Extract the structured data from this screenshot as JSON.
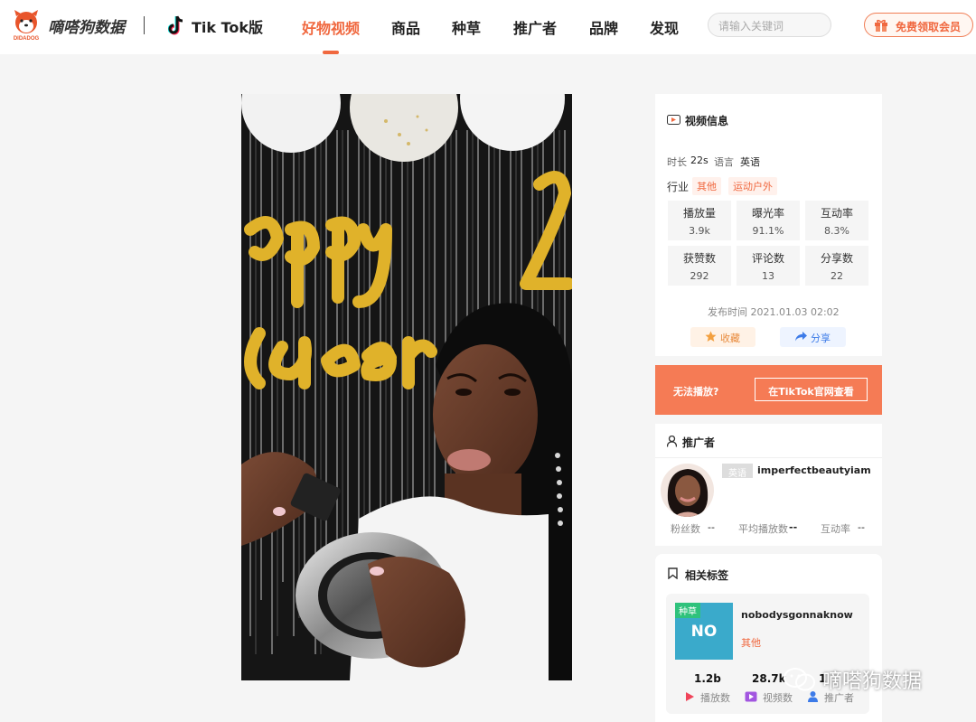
{
  "header": {
    "brand": "嘀嗒狗数据",
    "logo_caption": "DIDADOG",
    "platform": "Tik Tok版",
    "nav": [
      "好物视频",
      "商品",
      "种草",
      "推广者",
      "品牌",
      "发现"
    ],
    "active_nav": "好物视频",
    "search_placeholder": "请输入关键词",
    "vip_label": "免费领取会员"
  },
  "video_info": {
    "title": "视频信息",
    "duration_label": "时长",
    "duration": "22s",
    "language_label": "语言",
    "language": "英语",
    "industry_label": "行业",
    "industry_tags": [
      "其他",
      "运动户外"
    ],
    "stats": [
      {
        "label": "播放量",
        "value": "3.9k"
      },
      {
        "label": "曝光率",
        "value": "91.1%"
      },
      {
        "label": "互动率",
        "value": "8.3%"
      },
      {
        "label": "获赞数",
        "value": "292"
      },
      {
        "label": "评论数",
        "value": "13"
      },
      {
        "label": "分享数",
        "value": "22"
      }
    ],
    "publish_time": "发布时间 2021.01.03 02:02",
    "fav_label": "收藏",
    "share_label": "分享"
  },
  "unplayable": {
    "question": "无法播放?",
    "button": "在TikTok官网查看"
  },
  "promoter": {
    "title": "推广者",
    "language_badge": "英语",
    "name": "imperfectbeautyiam",
    "fans_label": "粉丝数",
    "fans": "--",
    "avg_play_label": "平均播放数",
    "avg_play": "--",
    "interaction_label": "互动率",
    "interaction": "--"
  },
  "related_tags": {
    "title": "相关标签",
    "kind": "种草",
    "thumb_text": "NO",
    "name": "nobodysgonnaknow",
    "category": "其他",
    "plays": "1.2b",
    "plays_label": "播放数",
    "videos": "28.7k",
    "videos_label": "视频数",
    "promoters": "1",
    "promoters_label": "推广者"
  },
  "watermark": "嘀嗒狗数据",
  "video_overlay_text": "ppy New Year"
}
